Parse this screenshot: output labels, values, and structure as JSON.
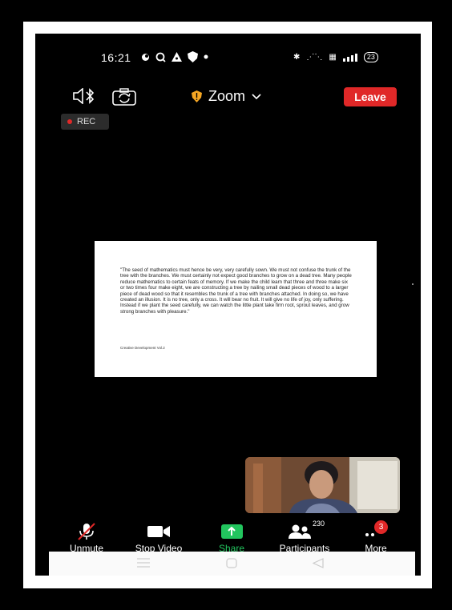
{
  "status_bar": {
    "time": "16:21",
    "icons": [
      "circle-icon",
      "search-icon",
      "triangle-icon",
      "shield-icon",
      "dot-icon"
    ],
    "right_icons": [
      "bluetooth-icon",
      "vibrate-icon",
      "network-icon",
      "signal-icon"
    ],
    "battery": "23"
  },
  "meeting": {
    "title": "Zoom",
    "leave_label": "Leave",
    "rec_label": "REC"
  },
  "shared_document": {
    "quote": "\"The seed of mathematics must hence be very, very carefully sown. We must not confuse the trunk of the tree with the branches. We must certainly not expect good branches to grow on a dead tree. Many people reduce mathematics to certain feats of memory. If we make the child learn that three and three make six or two times four make eight, we are constructing a tree by nailing small dead pieces of wood to a larger piece of dead wood so that it resembles the trunk of a tree with branches attached. In doing so, we have created an illusion. It is no tree, only a cross. It will bear no fruit. It will give no life of joy, only suffering. Instead if we plant the seed carefully, we can watch the little plant take firm root, sprout leaves, and grow strong branches with pleasure.\"",
    "caption": "Creative Development Vol.2"
  },
  "toolbar": {
    "unmute": "Unmute",
    "stop_video": "Stop Video",
    "share": "Share",
    "participants": "Participants",
    "participants_count": "230",
    "more": "More",
    "more_badge": "3"
  },
  "colors": {
    "accent_red": "#e02828",
    "share_green": "#22c55e"
  }
}
